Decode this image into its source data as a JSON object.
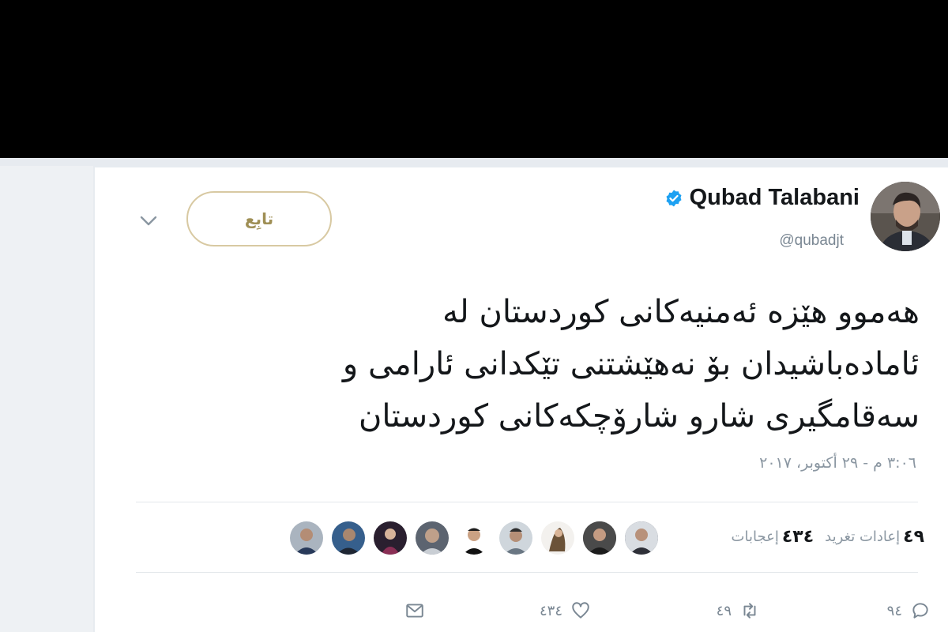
{
  "tweet": {
    "display_name": "Qubad Talabani",
    "handle": "@qubadjt",
    "follow_label": "تابِع",
    "text_lines": [
      "هەموو هێزە ئەمنیەکانی کوردستان لە",
      "ئامادەباشیدان بۆ نەهێشتنی تێکدانی ئارامی و",
      "سەقامگیری شارو شارۆچکەکانی کوردستان"
    ],
    "timestamp": "٣:٠٦ م - ٢٩ أكتوبر، ٢٠١٧",
    "stats": {
      "retweets_count": "٤٩",
      "retweets_label": "إعادات تغريد",
      "likes_count": "٤٣٤",
      "likes_label": "إعجابات"
    },
    "actions": {
      "reply_count": "٩٤",
      "retweet_count": "٤٩",
      "like_count": "٤٣٤"
    }
  },
  "colors": {
    "verified": "#1da1f2",
    "follow_border": "#d8c9a2",
    "follow_text": "#9f8f55",
    "text": "#14171a",
    "muted": "#8a96a1"
  },
  "icons": [
    "verified-badge-icon",
    "chevron-down-icon",
    "reply-icon",
    "retweet-icon",
    "like-icon",
    "direct-message-icon"
  ]
}
